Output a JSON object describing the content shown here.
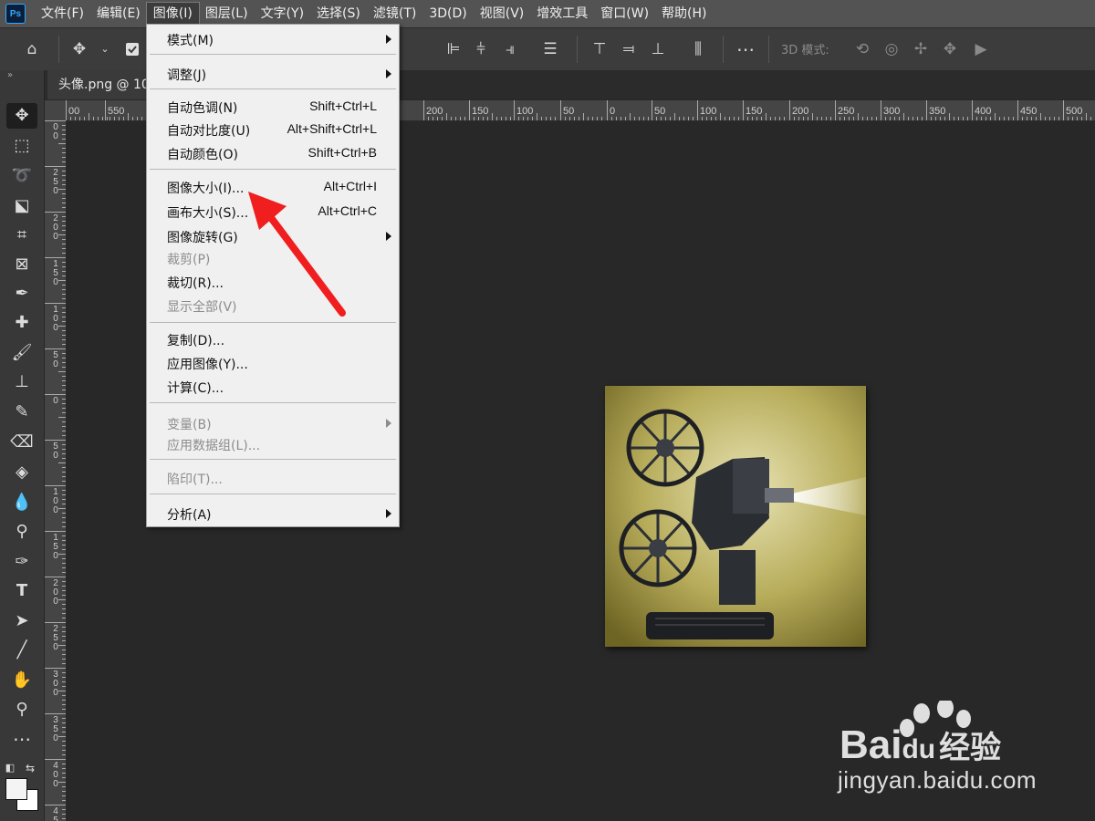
{
  "app": {
    "logo": "Ps"
  },
  "menubar": {
    "items": [
      "文件(F)",
      "编辑(E)",
      "图像(I)",
      "图层(L)",
      "文字(Y)",
      "选择(S)",
      "滤镜(T)",
      "3D(D)",
      "视图(V)",
      "增效工具",
      "窗口(W)",
      "帮助(H)"
    ],
    "active": "图像(I)"
  },
  "optionsbar": {
    "mode_3d_label": "3D 模式:"
  },
  "document": {
    "tab_title": "头像.png @ 10"
  },
  "rulers": {
    "top": [
      "00",
      "550",
      "200",
      "150",
      "100",
      "50",
      "0",
      "50",
      "100",
      "150",
      "200",
      "250",
      "300",
      "350",
      "400",
      "450",
      "500"
    ],
    "left": [
      "0 0",
      "2 5 0",
      "2 0 0",
      "1 5 0",
      "1 0 0",
      "5 0",
      "0",
      "5 0",
      "1 0 0",
      "1 5 0",
      "2 0 0",
      "2 5 0",
      "3 0 0",
      "3 5 0",
      "4 0 0",
      "4 5"
    ]
  },
  "image_menu": {
    "items": [
      {
        "label": "模式(M)",
        "shortcut": "",
        "submenu": true,
        "enabled": true
      },
      {
        "label": "调整(J)",
        "shortcut": "",
        "submenu": true,
        "enabled": true
      },
      {
        "label": "自动色调(N)",
        "shortcut": "Shift+Ctrl+L",
        "submenu": false,
        "enabled": true
      },
      {
        "label": "自动对比度(U)",
        "shortcut": "Alt+Shift+Ctrl+L",
        "submenu": false,
        "enabled": true
      },
      {
        "label": "自动颜色(O)",
        "shortcut": "Shift+Ctrl+B",
        "submenu": false,
        "enabled": true
      },
      {
        "label": "图像大小(I)...",
        "shortcut": "Alt+Ctrl+I",
        "submenu": false,
        "enabled": true
      },
      {
        "label": "画布大小(S)...",
        "shortcut": "Alt+Ctrl+C",
        "submenu": false,
        "enabled": true
      },
      {
        "label": "图像旋转(G)",
        "shortcut": "",
        "submenu": true,
        "enabled": true
      },
      {
        "label": "裁剪(P)",
        "shortcut": "",
        "submenu": false,
        "enabled": false
      },
      {
        "label": "裁切(R)...",
        "shortcut": "",
        "submenu": false,
        "enabled": true
      },
      {
        "label": "显示全部(V)",
        "shortcut": "",
        "submenu": false,
        "enabled": false
      },
      {
        "label": "复制(D)...",
        "shortcut": "",
        "submenu": false,
        "enabled": true
      },
      {
        "label": "应用图像(Y)...",
        "shortcut": "",
        "submenu": false,
        "enabled": true
      },
      {
        "label": "计算(C)...",
        "shortcut": "",
        "submenu": false,
        "enabled": true
      },
      {
        "label": "变量(B)",
        "shortcut": "",
        "submenu": true,
        "enabled": false
      },
      {
        "label": "应用数据组(L)...",
        "shortcut": "",
        "submenu": false,
        "enabled": false
      },
      {
        "label": "陷印(T)...",
        "shortcut": "",
        "submenu": false,
        "enabled": false
      },
      {
        "label": "分析(A)",
        "shortcut": "",
        "submenu": true,
        "enabled": true
      }
    ]
  },
  "annotation": {
    "arrow_color": "#f01e1e",
    "target": "图像大小(I)..."
  },
  "watermark": {
    "brand": "Bai",
    "brand_suffix": "经验",
    "url": "jingyan.baidu.com"
  },
  "colors": {
    "accent": "#31a8ff",
    "menu_bg": "#f0f0f0",
    "canvas_bg": "#282828"
  }
}
